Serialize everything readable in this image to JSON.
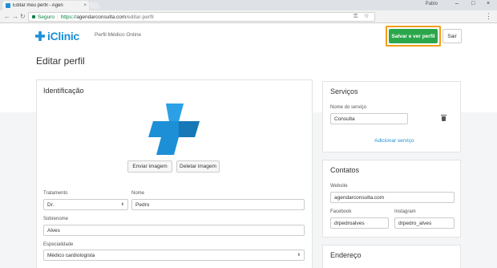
{
  "browser": {
    "tab_title": "Editar meu perfil - Agen",
    "tab_close": "×",
    "profile": "Pablo",
    "minimize": "–",
    "maximize": "□",
    "close": "×",
    "back": "←",
    "forward": "→",
    "reload": "↻",
    "secure_label": "Seguro",
    "separator": "|",
    "url_scheme": "https://",
    "url_host": "agendarconsulta.com",
    "url_path": "/editar-perfil",
    "omni_icons": "⚿ ☆",
    "menu": "⋮"
  },
  "header": {
    "logo_text": "iClinic",
    "subtitle": "Perfil Médico Online",
    "save_label": "Salvar e ver perfil",
    "exit_label": "Sair"
  },
  "page": {
    "title": "Editar perfil"
  },
  "identificacao": {
    "title": "Identificação",
    "upload_label": "Enviar imagem",
    "delete_label": "Deletar imagem",
    "tratamento_label": "Tratamento",
    "tratamento_value": "Dr.",
    "nome_label": "Nome",
    "nome_value": "Pedro",
    "sobrenome_label": "Sobrenome",
    "sobrenome_value": "Alves",
    "especialidade_label": "Especialidade",
    "especialidade_value": "Médico cardiologista",
    "select_caret": "⬍"
  },
  "servicos": {
    "title": "Serviços",
    "nome_label": "Nome do serviço",
    "nome_value": "Consulta",
    "add_label": "Adicionar serviço"
  },
  "contatos": {
    "title": "Contatos",
    "website_label": "Website",
    "website_value": "agendarconsulta.com",
    "facebook_label": "Facebook",
    "facebook_value": "drpedroalves",
    "instagram_label": "Instagram",
    "instagram_value": "drpedro_alves"
  },
  "endereco": {
    "title": "Endereço"
  },
  "colors": {
    "brand": "#1c8fd6",
    "save": "#2aa74a",
    "highlight": "#f39c12"
  }
}
